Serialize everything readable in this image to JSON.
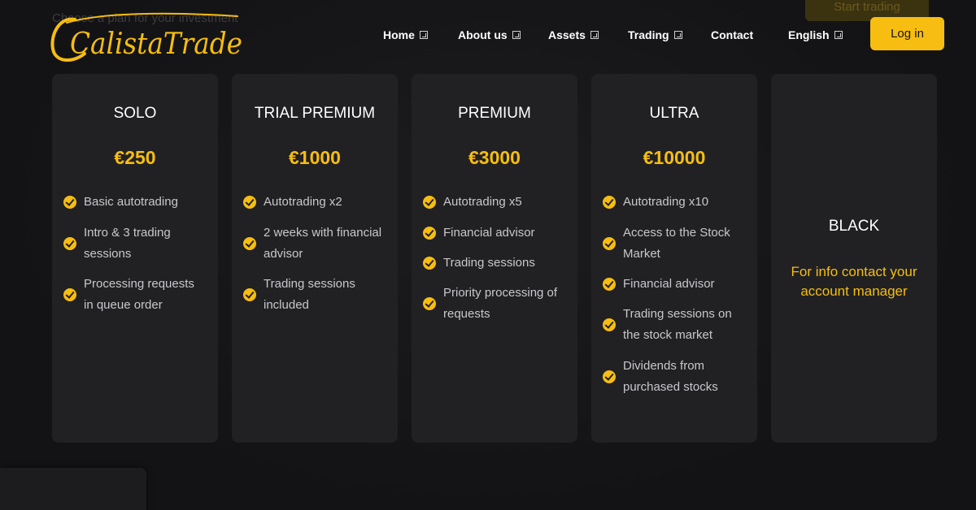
{
  "background": {
    "ghost_heading": "Choose a plan for your investment",
    "ghost_button": "Start trading"
  },
  "brand": {
    "logo_text": "CalistaTrade",
    "accent_color": "#f7bd10"
  },
  "nav": {
    "items": [
      {
        "label": "Home",
        "has_dropdown": true
      },
      {
        "label": "About us",
        "has_dropdown": true
      },
      {
        "label": "Assets",
        "has_dropdown": true
      },
      {
        "label": "Trading",
        "has_dropdown": true
      },
      {
        "label": "Contact",
        "has_dropdown": false
      },
      {
        "label": "English",
        "has_dropdown": true
      }
    ],
    "login_label": "Log in"
  },
  "plans": [
    {
      "name": "SOLO",
      "price": "€250",
      "features": [
        "Basic autotrading",
        "Intro & 3 trading sessions",
        "Processing requests in queue order"
      ]
    },
    {
      "name": "TRIAL PREMIUM",
      "price": "€1000",
      "features": [
        "Autotrading x2",
        "2 weeks with financial advisor",
        "Trading sessions included"
      ]
    },
    {
      "name": "PREMIUM",
      "price": "€3000",
      "features": [
        "Autotrading x5",
        "Financial advisor",
        "Trading sessions",
        "Priority processing of requests"
      ]
    },
    {
      "name": "ULTRA",
      "price": "€10000",
      "features": [
        "Autotrading x10",
        "Access to the Stock Market",
        "Financial advisor",
        "Trading sessions on the stock market",
        "Dividends from purchased stocks"
      ]
    },
    {
      "name": "BLACK",
      "info": "For info contact your account manager"
    }
  ]
}
